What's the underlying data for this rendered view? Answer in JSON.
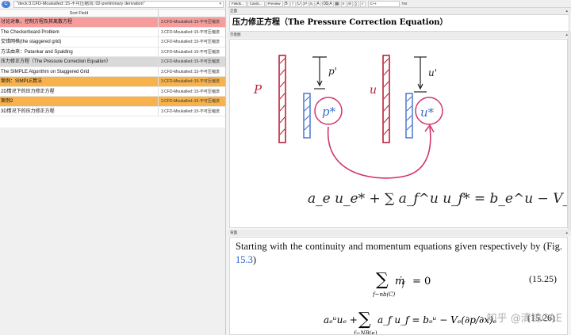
{
  "search": {
    "toggle_glyph": "C",
    "query": "\"deck:3.CFD-Moukalled::15-不可压缩流::02-preliminary derivation\""
  },
  "table": {
    "header_sort_field": "Sort Field",
    "header_deck": "",
    "deck_text": "3.CFD-Moukalled::15-不可压缩流",
    "rows": [
      {
        "sort_field": "讨论对象，控制方程及其离散方程",
        "deck": "3.CFD-Moukalled::15-不可压缩流",
        "style": "red"
      },
      {
        "sort_field": "The Checkerboard Problem",
        "deck": "3.CFD-Moukalled::15-不可压缩流",
        "style": "normal"
      },
      {
        "sort_field": "交错网格(the staggered grid)",
        "deck": "3.CFD-Moukalled::15-不可压缩流",
        "style": "normal"
      },
      {
        "sort_field": "方法由来：Patankar and Spalding",
        "deck": "3.CFD-Moukalled::15-不可压缩流",
        "style": "normal"
      },
      {
        "sort_field": "压力修正方程（The Pressure Correction Equation）",
        "deck": "3.CFD-Moukalled::15-不可压缩流",
        "style": "gray"
      },
      {
        "sort_field": "The SIMPLE Algorithm on Staggered Grid",
        "deck": "3.CFD-Moukalled::15-不可压缩流",
        "style": "normal"
      },
      {
        "sort_field": "案例：SIMPLE算法",
        "deck": "3.CFD-Moukalled::15-不可压缩流",
        "style": "orange"
      },
      {
        "sort_field": "2D情况下的压力修正方程",
        "deck": "3.CFD-Moukalled::15-不可压缩流",
        "style": "normal"
      },
      {
        "sort_field": "案例2",
        "deck": "3.CFD-Moukalled::15-不可压缩流",
        "style": "orange"
      },
      {
        "sort_field": "3D情况下的压力修正方程",
        "deck": "3.CFD-Moukalled::15-不可压缩流",
        "style": "normal"
      }
    ]
  },
  "editor": {
    "toolbar": {
      "fields_label": "Fields...",
      "cards_label": "Cards...",
      "preview_label": "Preview",
      "icons": [
        "B",
        "I",
        "U",
        "x²",
        "x₂",
        "A",
        "⌫",
        "A",
        "▦",
        "≡",
        "⊘",
        "∑",
        "√"
      ],
      "font_select": "C++",
      "tail": "TM"
    },
    "front_label": "正面",
    "front_text": "压力修正方程（The Pressure Correction Equation）",
    "image_label": "示意图",
    "image_equation": "a_e u_e* + ∑ a_f^u u_f* = b_e^u − V_e (∂p*/∂x)_e",
    "answer_label": "背面",
    "answer_text_before": "Starting with the continuity and momentum equations given respectively by (Fig. ",
    "answer_ref": "15.3",
    "answer_text_after": ")",
    "eq1_number": "(15.25)",
    "eq2_number": "(15.26)",
    "watermark": "知乎 @清锦CAE"
  },
  "colors": {
    "row_red": "#f59d9d",
    "row_gray": "#d9d9d9",
    "row_orange": "#f7b24b",
    "ink_red": "#b8233a",
    "ink_blue": "#3d6fc9",
    "ink_pink": "#d2356a",
    "link_blue": "#1f5fd0"
  }
}
